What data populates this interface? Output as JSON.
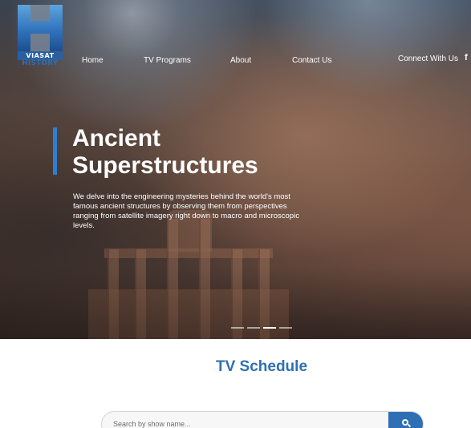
{
  "logo": {
    "line1": "VIASAT",
    "line2": "HISTORY"
  },
  "nav": {
    "items": [
      {
        "label": "Home"
      },
      {
        "label": "TV Programs"
      },
      {
        "label": "About"
      },
      {
        "label": "Contact Us"
      }
    ],
    "connect_label": "Connect With Us",
    "social_icon": "f"
  },
  "hero": {
    "title": "Ancient Superstructures",
    "description": "We delve into the engineering mysteries behind the world's most famous ancient structures by observing them from perspectives ranging from satellite imagery right down to macro and microscopic levels.",
    "slides_total": 4,
    "active_slide": 3,
    "accent_color": "#2f7fd1"
  },
  "schedule": {
    "title": "TV Schedule",
    "search_placeholder": "Search by show name...",
    "brand_color": "#2f6fb4"
  }
}
